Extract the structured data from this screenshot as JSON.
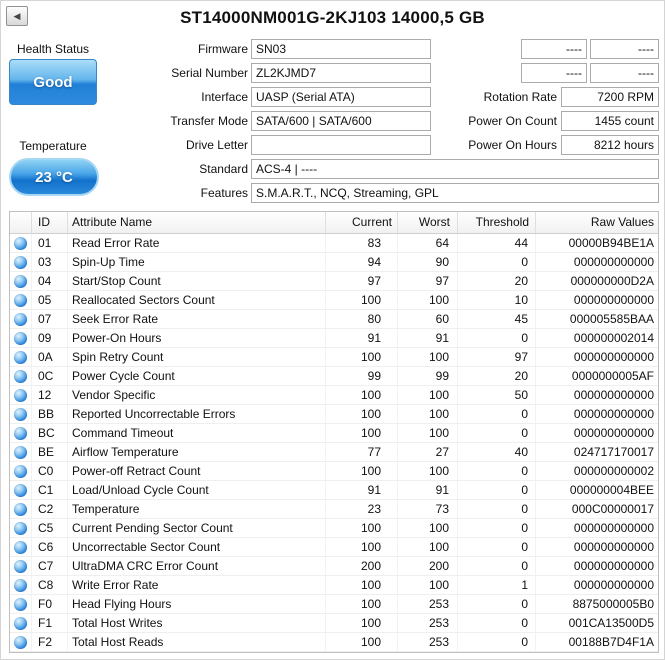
{
  "title": "ST14000NM001G-2KJ103 14000,5 GB",
  "back_icon": "◀",
  "health": {
    "label": "Health Status",
    "value": "Good"
  },
  "temperature": {
    "label": "Temperature",
    "value": "23 °C"
  },
  "info_fields": [
    {
      "label": "Firmware",
      "value": "SN03"
    },
    {
      "label": "Serial Number",
      "value": "ZL2KJMD7"
    },
    {
      "label": "Interface",
      "value": "UASP (Serial ATA)"
    },
    {
      "label": "Transfer Mode",
      "value": "SATA/600 | SATA/600"
    },
    {
      "label": "Drive Letter",
      "value": ""
    },
    {
      "label": "Standard",
      "value": "ACS-4 | ----"
    },
    {
      "label": "Features",
      "value": "S.M.A.R.T., NCQ, Streaming, GPL"
    }
  ],
  "dash_fields": [
    {
      "a": "----",
      "b": "----"
    },
    {
      "a": "----",
      "b": "----"
    }
  ],
  "stat_fields": [
    {
      "label": "Rotation Rate",
      "value": "7200 RPM"
    },
    {
      "label": "Power On Count",
      "value": "1455 count"
    },
    {
      "label": "Power On Hours",
      "value": "8212 hours"
    }
  ],
  "table": {
    "headers": {
      "id": "ID",
      "name": "Attribute Name",
      "current": "Current",
      "worst": "Worst",
      "threshold": "Threshold",
      "raw": "Raw Values"
    },
    "rows": [
      {
        "id": "01",
        "name": "Read Error Rate",
        "current": "83",
        "worst": "64",
        "threshold": "44",
        "raw": "00000B94BE1A"
      },
      {
        "id": "03",
        "name": "Spin-Up Time",
        "current": "94",
        "worst": "90",
        "threshold": "0",
        "raw": "000000000000"
      },
      {
        "id": "04",
        "name": "Start/Stop Count",
        "current": "97",
        "worst": "97",
        "threshold": "20",
        "raw": "000000000D2A"
      },
      {
        "id": "05",
        "name": "Reallocated Sectors Count",
        "current": "100",
        "worst": "100",
        "threshold": "10",
        "raw": "000000000000"
      },
      {
        "id": "07",
        "name": "Seek Error Rate",
        "current": "80",
        "worst": "60",
        "threshold": "45",
        "raw": "000005585BAA"
      },
      {
        "id": "09",
        "name": "Power-On Hours",
        "current": "91",
        "worst": "91",
        "threshold": "0",
        "raw": "000000002014"
      },
      {
        "id": "0A",
        "name": "Spin Retry Count",
        "current": "100",
        "worst": "100",
        "threshold": "97",
        "raw": "000000000000"
      },
      {
        "id": "0C",
        "name": "Power Cycle Count",
        "current": "99",
        "worst": "99",
        "threshold": "20",
        "raw": "0000000005AF"
      },
      {
        "id": "12",
        "name": "Vendor Specific",
        "current": "100",
        "worst": "100",
        "threshold": "50",
        "raw": "000000000000"
      },
      {
        "id": "BB",
        "name": "Reported Uncorrectable Errors",
        "current": "100",
        "worst": "100",
        "threshold": "0",
        "raw": "000000000000"
      },
      {
        "id": "BC",
        "name": "Command Timeout",
        "current": "100",
        "worst": "100",
        "threshold": "0",
        "raw": "000000000000"
      },
      {
        "id": "BE",
        "name": "Airflow Temperature",
        "current": "77",
        "worst": "27",
        "threshold": "40",
        "raw": "024717170017"
      },
      {
        "id": "C0",
        "name": "Power-off Retract Count",
        "current": "100",
        "worst": "100",
        "threshold": "0",
        "raw": "000000000002"
      },
      {
        "id": "C1",
        "name": "Load/Unload Cycle Count",
        "current": "91",
        "worst": "91",
        "threshold": "0",
        "raw": "000000004BEE"
      },
      {
        "id": "C2",
        "name": "Temperature",
        "current": "23",
        "worst": "73",
        "threshold": "0",
        "raw": "000C00000017"
      },
      {
        "id": "C5",
        "name": "Current Pending Sector Count",
        "current": "100",
        "worst": "100",
        "threshold": "0",
        "raw": "000000000000"
      },
      {
        "id": "C6",
        "name": "Uncorrectable Sector Count",
        "current": "100",
        "worst": "100",
        "threshold": "0",
        "raw": "000000000000"
      },
      {
        "id": "C7",
        "name": "UltraDMA CRC Error Count",
        "current": "200",
        "worst": "200",
        "threshold": "0",
        "raw": "000000000000"
      },
      {
        "id": "C8",
        "name": "Write Error Rate",
        "current": "100",
        "worst": "100",
        "threshold": "1",
        "raw": "000000000000"
      },
      {
        "id": "F0",
        "name": "Head Flying Hours",
        "current": "100",
        "worst": "253",
        "threshold": "0",
        "raw": "8875000005B0"
      },
      {
        "id": "F1",
        "name": "Total Host Writes",
        "current": "100",
        "worst": "253",
        "threshold": "0",
        "raw": "001CA13500D5"
      },
      {
        "id": "F2",
        "name": "Total Host Reads",
        "current": "100",
        "worst": "253",
        "threshold": "0",
        "raw": "00188B7D4F1A"
      }
    ]
  },
  "colors": {
    "health_good_blue": "#2180d6",
    "temp_blue": "#1272cc",
    "status_dot_blue": "#1976d4",
    "table_border": "#c0c0c0"
  }
}
